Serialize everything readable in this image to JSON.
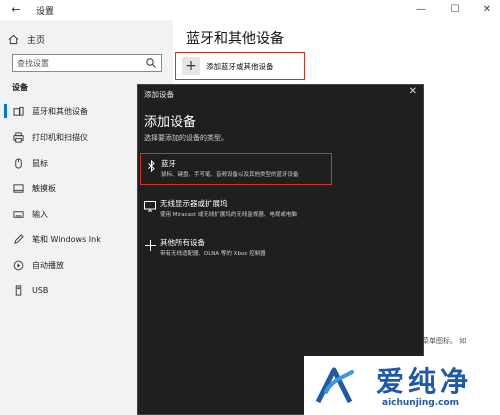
{
  "window": {
    "title": "设置",
    "back_glyph": "←",
    "minimize_glyph": "—",
    "maximize_glyph": "☐",
    "close_glyph": "✕"
  },
  "sidebar": {
    "home_label": "主页",
    "search_placeholder": "查找设置",
    "section_label": "设备",
    "items": [
      {
        "label": "蓝牙和其他设备",
        "icon": "bluetooth-devices-icon",
        "active": true
      },
      {
        "label": "打印机和扫描仪",
        "icon": "printer-icon",
        "active": false
      },
      {
        "label": "鼠标",
        "icon": "mouse-icon",
        "active": false
      },
      {
        "label": "触摸板",
        "icon": "touchpad-icon",
        "active": false
      },
      {
        "label": "输入",
        "icon": "keyboard-icon",
        "active": false
      },
      {
        "label": "笔和 Windows Ink",
        "icon": "pen-icon",
        "active": false
      },
      {
        "label": "自动播放",
        "icon": "autoplay-icon",
        "active": false
      },
      {
        "label": "USB",
        "icon": "usb-icon",
        "active": false
      }
    ]
  },
  "main": {
    "title": "蓝牙和其他设备",
    "add_button_label": "添加蓝牙或其他设备",
    "obscured_text_right": "菜单图标。 如"
  },
  "dialog": {
    "title": "添加设备",
    "close_glyph": "✕",
    "heading": "添加设备",
    "subtitle": "选择要添加的设备的类型。",
    "options": [
      {
        "title": "蓝牙",
        "description": "鼠标、键盘、手写笔、音频设备以及其他类型的蓝牙设备",
        "icon": "bluetooth-icon",
        "selected": true
      },
      {
        "title": "无线显示器或扩展坞",
        "description": "使用 Miracast 或无线扩展坞的无线监视器、电视或电脑",
        "icon": "monitor-icon",
        "selected": false
      },
      {
        "title": "其他所有设备",
        "description": "带有无线适配器、DLNA 等的 Xbox 控制器",
        "icon": "plus-icon",
        "selected": false
      }
    ]
  },
  "watermark": {
    "text": "爱纯净",
    "url": "aichunjing.com"
  },
  "colors": {
    "accent": "#0078d7",
    "highlight_border": "#d9302b",
    "dialog_bg": "#1f1f1f",
    "watermark_blue": "#1e5aa8"
  }
}
